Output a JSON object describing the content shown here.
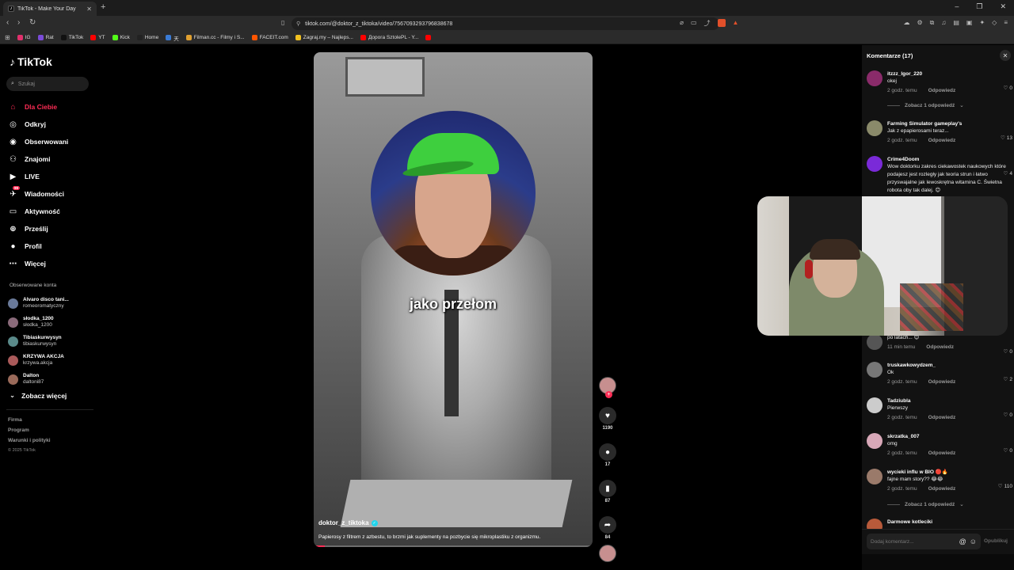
{
  "browser": {
    "tab_title": "TikTok - Make Your Day",
    "url": "tiktok.com/@doktor_z_tiktoka/video/7567093293796838678",
    "shield_count": "4",
    "bookmarks": [
      {
        "label": "IG",
        "color": "#e1306c"
      },
      {
        "label": "Rat",
        "color": "#7b4bd8"
      },
      {
        "label": "TikTok",
        "color": "#111111"
      },
      {
        "label": "YT",
        "color": "#ff0000"
      },
      {
        "label": "Kick",
        "color": "#53fc18"
      },
      {
        "label": "Home",
        "color": "#222222"
      },
      {
        "label": "天",
        "color": "#3a7bd5"
      },
      {
        "label": "Filman.cc - Filmy i S...",
        "color": "#e0a030"
      },
      {
        "label": "FACEIT.com",
        "color": "#ff5500"
      },
      {
        "label": "Zagraj.my – Najleps...",
        "color": "#f0c020"
      },
      {
        "label": "Дорога SztolePL - Y...",
        "color": "#ff0000"
      },
      {
        "label": "",
        "color": "#ff0000"
      }
    ]
  },
  "sidebar": {
    "logo": "TikTok",
    "search_placeholder": "Szukaj",
    "nav": [
      {
        "label": "Dla Ciebie",
        "icon": "home-icon",
        "active": true
      },
      {
        "label": "Odkryj",
        "icon": "compass-icon"
      },
      {
        "label": "Obserwowani",
        "icon": "following-icon"
      },
      {
        "label": "Znajomi",
        "icon": "friends-icon"
      },
      {
        "label": "LIVE",
        "icon": "live-icon"
      },
      {
        "label": "Wiadomości",
        "icon": "messages-icon",
        "badge": "99"
      },
      {
        "label": "Aktywność",
        "icon": "activity-icon"
      },
      {
        "label": "Prześlij",
        "icon": "upload-icon"
      },
      {
        "label": "Profil",
        "icon": "profile-icon"
      },
      {
        "label": "Więcej",
        "icon": "more-icon"
      }
    ],
    "followed_title": "Obserwowane konta",
    "followed": [
      {
        "name": "Alvaro disco tani...",
        "user": "romeoromatyczny"
      },
      {
        "name": "słodka_1200",
        "user": "słodka_1200"
      },
      {
        "name": "Tibiaskurwysyn",
        "user": "tibiaskurwysyn"
      },
      {
        "name": "KRZYWA AKCJA",
        "user": "krzywa.akcja"
      },
      {
        "name": "Dalton",
        "user": "daltoni87"
      }
    ],
    "see_more": "Zobacz więcej",
    "footer": [
      "Firma",
      "Program",
      "Warunki i polityki"
    ],
    "copyright": "© 2025 TikTok"
  },
  "video": {
    "caption": "jako przełom",
    "author": "doktor_z_tiktoka",
    "description": "Papierosy z filtrem z azbestu, to brzmi jak suplementy na pozbycie się mikroplastiku z organizmu.",
    "progress": 0.04,
    "likes": "1190",
    "comments": "17",
    "saves": "87",
    "shares": "84"
  },
  "comments": {
    "title": "Komentarze (17)",
    "reply_label": "Odpowiedz",
    "view_replies": "Zobacz 1 odpowiedź",
    "input_placeholder": "Dodaj komentarz...",
    "post_label": "Opublikuj",
    "items": [
      {
        "user": "itzzz_lgor_220",
        "text": "okej",
        "time": "2 godz. temu",
        "likes": "0",
        "color": "#8a2b6a"
      },
      {
        "user": "Farming Simulator gameplay's",
        "text": "Jak z epapierosami teraz...",
        "time": "2 godz. temu",
        "likes": "13",
        "color": "#8a8a6a"
      },
      {
        "user": "Crime4Doom",
        "text": "Wow doktorku zakres ciekawostek naukowych które podajesz jest rozległy jak teoria strun i łatwo przyswajalne jak lewoskrętna witamina C. Świetna robota oby tak dalej. 😊",
        "time": "",
        "likes": "4",
        "color": "#7a2ad8"
      },
      {
        "user": "",
        "text": "po latach... 😊",
        "time": "11 min temu",
        "likes": "0",
        "color": "#555555"
      },
      {
        "user": "truskawkowydzem_",
        "text": "Ok",
        "time": "2 godz. temu",
        "likes": "2",
        "color": "#777777"
      },
      {
        "user": "Tadziubla",
        "text": "Pierwszy",
        "time": "2 godz. temu",
        "likes": "0",
        "color": "#cccccc"
      },
      {
        "user": "skrzatka_007",
        "text": "omg",
        "time": "2 godz. temu",
        "likes": "0",
        "color": "#d8a8b8"
      },
      {
        "user": "wycieki influ w BIO 🔴🔥",
        "text": "fajne mam story?? 😂😂",
        "time": "2 godz. temu",
        "likes": "110",
        "color": "#9a7a6a"
      },
      {
        "user": "Darmowe kotleciki",
        "text": "",
        "time": "",
        "likes": "",
        "color": "#b85a3a"
      }
    ]
  }
}
